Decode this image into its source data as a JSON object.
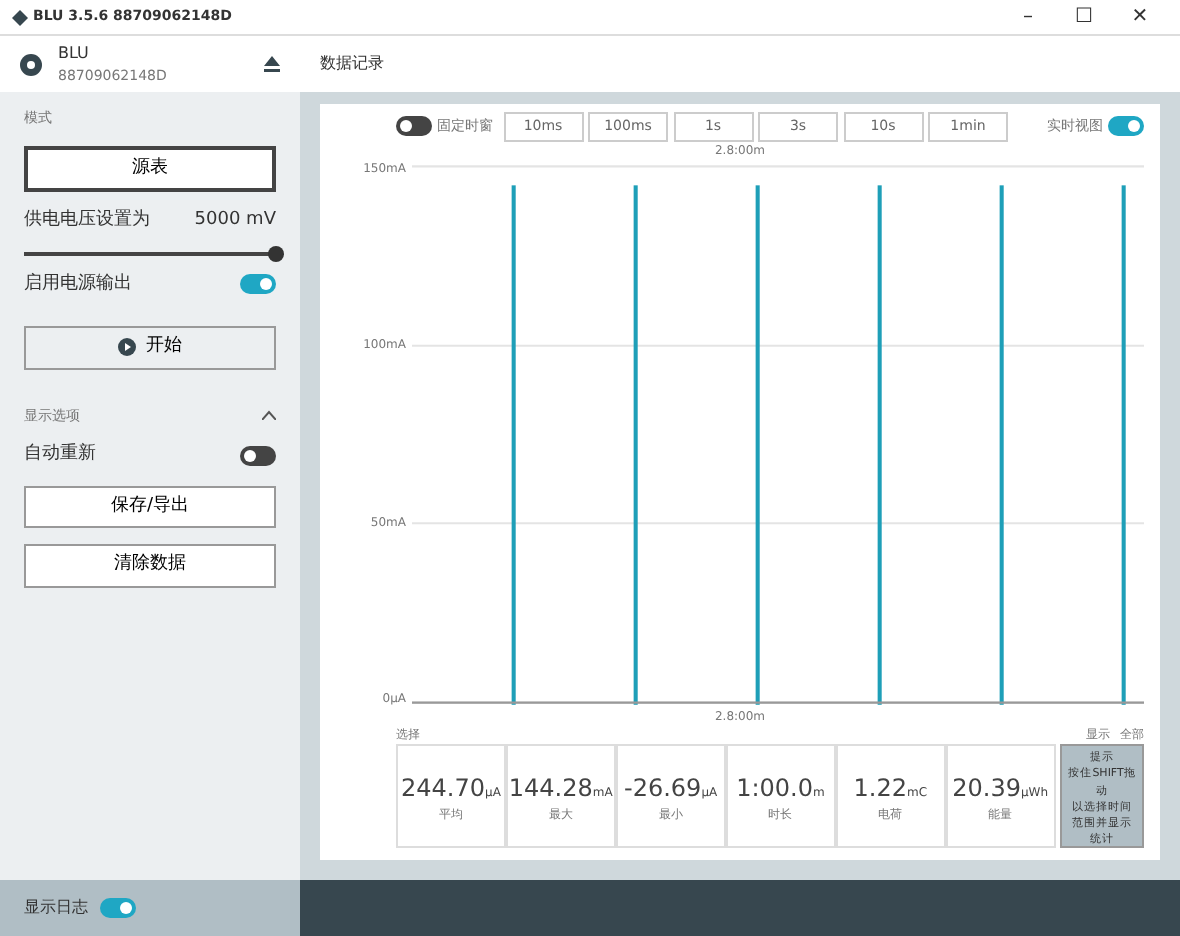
{
  "window": {
    "title": "BLU 3.5.6 88709062148D",
    "controls": [
      "–",
      "☐",
      "✕"
    ]
  },
  "device": {
    "name": "BLU",
    "serial": "88709062148D"
  },
  "header": {
    "title": "数据记录"
  },
  "sidebar": [
    {
      "kind": "heading",
      "label": "模式"
    },
    {
      "kind": "button",
      "label": "源表",
      "selected": true
    },
    {
      "kind": "slider",
      "label": "供电电压设置为",
      "reading": "5000 mV",
      "level": 1
    },
    {
      "kind": "toggle",
      "label": "启用电源输出",
      "on": true
    },
    {
      "kind": "start",
      "label": "开始"
    },
    {
      "kind": "section",
      "label": "显示选项",
      "expanded": true
    },
    {
      "kind": "toggle",
      "label": "自动重新",
      "on": false
    },
    {
      "kind": "button",
      "label": "保存/导出",
      "selected": false
    },
    {
      "kind": "button",
      "label": "清除数据",
      "selected": false
    }
  ],
  "toolbar": {
    "live_toggle": {
      "label": "固定时窗",
      "on": false
    },
    "windows": [
      "10ms",
      "100ms",
      "1s",
      "3s",
      "10s",
      "1min"
    ],
    "realtime_toggle": {
      "label": "实时视图",
      "on": true
    }
  },
  "chart": {
    "top_time": "2.8:00m",
    "bottom_time": "2.8:00m",
    "y_labels": [
      "150mA",
      "100mA",
      "50mA",
      "0µA"
    ]
  },
  "stats": {
    "title": "选择",
    "side_title": "显示",
    "side_link": "全部",
    "items": [
      {
        "value": "244.70",
        "unit": "µA",
        "label": "平均"
      },
      {
        "value": "144.28",
        "unit": "mA",
        "label": "最大"
      },
      {
        "value": "-26.69",
        "unit": "µA",
        "label": "最小"
      },
      {
        "value": "1:00.0",
        "unit": "m",
        "label": "时长"
      },
      {
        "value": "1.22",
        "unit": "mC",
        "label": "电荷"
      },
      {
        "value": "20.39",
        "unit": "µWh",
        "label": "能量"
      }
    ],
    "hint": [
      "提示",
      "按住SHIFT拖动",
      "以选择时间",
      "范围并显示",
      "统计"
    ]
  },
  "footer": {
    "label": "显示日志",
    "on": true
  }
}
